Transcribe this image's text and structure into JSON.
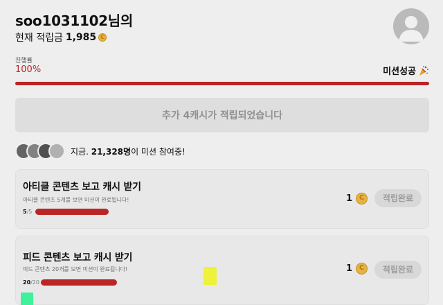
{
  "header": {
    "username": "soo1031102님의",
    "points_label": "현재 적립금",
    "points_value": "1,985",
    "coin_glyph": "C"
  },
  "progress": {
    "label": "진행률",
    "percent_text": "100%",
    "value": 1.0,
    "status_text": "미션성공",
    "status_icon": "party-popper-icon"
  },
  "banner": {
    "text": "추가 4캐시가 적립되었습니다"
  },
  "participants": {
    "prefix": "지금. ",
    "count": "21,328명",
    "suffix": "이 미션 참여중!"
  },
  "missions": [
    {
      "title": "아티클 콘텐츠 보고 캐시 받기",
      "description": "아티클 콘텐츠 5개를 보면 미션이 완료됩니다!",
      "done": "5",
      "total": "/5",
      "progress": 1.0,
      "reward": "1",
      "button_label": "적립완료"
    },
    {
      "title": "피드 콘텐츠 보고 캐시 받기",
      "description": "피드 콘텐츠 20개를 보면 미션이 완료됩니다!",
      "done": "20",
      "total": "/20",
      "progress": 1.0,
      "reward": "1",
      "button_label": "적립완료"
    }
  ],
  "colors": {
    "accent_red": "#c62828",
    "coin_gold": "#f2c04a",
    "marker_yellow": "#eef23a",
    "marker_green": "#3ff19a"
  }
}
